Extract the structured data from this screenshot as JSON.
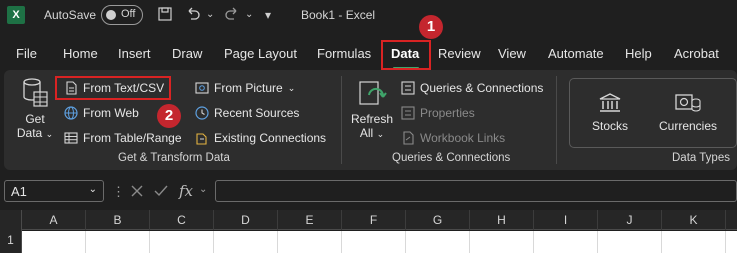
{
  "title_bar": {
    "autosave_label": "AutoSave",
    "autosave_state": "Off",
    "book_title": "Book1  -  Excel",
    "app_icon_letter": "X"
  },
  "tabs": [
    "File",
    "Home",
    "Insert",
    "Draw",
    "Page Layout",
    "Formulas",
    "Data",
    "Review",
    "View",
    "Automate",
    "Help",
    "Acrobat"
  ],
  "active_tab": "Data",
  "callouts": {
    "first": "1",
    "second": "2"
  },
  "ribbon": {
    "get_transform": {
      "get_data_line1": "Get",
      "get_data_line2": "Data",
      "from_text_csv": "From Text/CSV",
      "from_web": "From Web",
      "from_table_range": "From Table/Range",
      "from_picture": "From Picture",
      "recent_sources": "Recent Sources",
      "existing_connections": "Existing Connections",
      "group_label": "Get & Transform Data"
    },
    "queries": {
      "refresh_line1": "Refresh",
      "refresh_line2": "All",
      "queries_connections": "Queries & Connections",
      "properties": "Properties",
      "workbook_links": "Workbook Links",
      "group_label": "Queries & Connections"
    },
    "data_types": {
      "stocks": "Stocks",
      "currencies": "Currencies",
      "group_label": "Data Types"
    }
  },
  "formula_bar": {
    "name_box": "A1",
    "fx": "fx",
    "formula": ""
  },
  "grid": {
    "columns": [
      "A",
      "B",
      "C",
      "D",
      "E",
      "F",
      "G",
      "H",
      "I",
      "J",
      "K"
    ],
    "rows": [
      "1"
    ]
  },
  "colors": {
    "accent_green": "#3fa46a",
    "highlight_red": "#d92323",
    "callout_red": "#c4262e"
  }
}
